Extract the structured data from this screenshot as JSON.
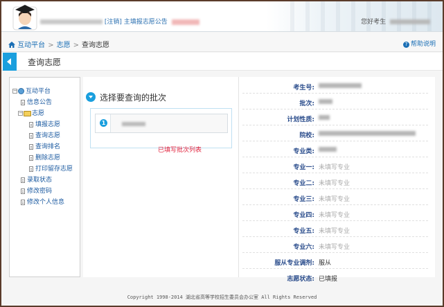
{
  "header": {
    "welcome_prefix": "[注销]",
    "announcement": "主填报志愿公告",
    "user_label": "您好考生"
  },
  "breadcrumb": {
    "home": "互动平台",
    "section": "志愿",
    "current": "查询志愿"
  },
  "help_label": "帮助说明",
  "page_title": "查询志愿",
  "sidebar": {
    "root": "互动平台",
    "items": [
      {
        "label": "信息公告",
        "level": 1,
        "icon": "doc-icon"
      },
      {
        "label": "志愿",
        "level": 1,
        "icon": "folder-icon"
      },
      {
        "label": "填报志愿",
        "level": 2,
        "icon": "doc-icon"
      },
      {
        "label": "查询志愿",
        "level": 2,
        "icon": "doc-icon"
      },
      {
        "label": "查询排名",
        "level": 2,
        "icon": "doc-icon"
      },
      {
        "label": "删除志愿",
        "level": 2,
        "icon": "doc-icon"
      },
      {
        "label": "打印留存志愿",
        "level": 2,
        "icon": "doc-icon"
      },
      {
        "label": "录取状态",
        "level": 1,
        "icon": "doc-icon"
      },
      {
        "label": "修改密码",
        "level": 1,
        "icon": "doc-icon"
      },
      {
        "label": "修改个人信息",
        "level": 1,
        "icon": "doc-icon"
      }
    ]
  },
  "batch_section": {
    "heading": "选择要查询的批次",
    "badge": "1",
    "filled_list_link": "已填写批次列表"
  },
  "details": [
    {
      "label": "考生号:",
      "value": "",
      "blurred": true
    },
    {
      "label": "批次:",
      "value": "",
      "blurred": true
    },
    {
      "label": "计划性质:",
      "value": "",
      "blurred": true
    },
    {
      "label": "院校:",
      "value": "",
      "blurred": true
    },
    {
      "label": "专业类:",
      "value": "",
      "blurred": true
    },
    {
      "label": "专业一:",
      "value": "未填写专业",
      "muted": true
    },
    {
      "label": "专业二:",
      "value": "未填写专业",
      "muted": true
    },
    {
      "label": "专业三:",
      "value": "未填写专业",
      "muted": true
    },
    {
      "label": "专业四:",
      "value": "未填写专业",
      "muted": true
    },
    {
      "label": "专业五:",
      "value": "未填写专业",
      "muted": true
    },
    {
      "label": "专业六:",
      "value": "未填写专业",
      "muted": true
    },
    {
      "label": "服从专业调剂:",
      "value": "服从"
    },
    {
      "label": "志愿状态:",
      "value": "已填报"
    }
  ],
  "footer": "Copyright 1998-2014 湖北省高等学校招生委员会办公室 All Rights Reserved",
  "colors": {
    "accent": "#1a9fde",
    "label": "#2b4d8c",
    "link": "#1b6fb5",
    "alert": "#e2233d"
  }
}
